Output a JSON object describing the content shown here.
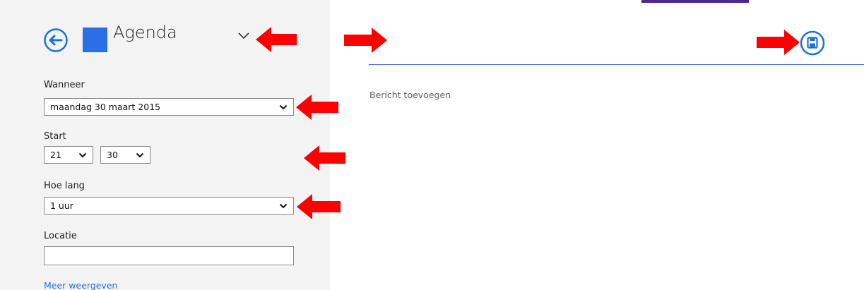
{
  "header": {
    "back_icon": "back-arrow-circle-icon",
    "calendar_color": "#2b6ee6",
    "calendar_name": "Agenda",
    "dropdown_icon": "chevron-down-icon"
  },
  "form": {
    "when": {
      "label": "Wanneer",
      "value": "maandag 30 maart 2015"
    },
    "start": {
      "label": "Start",
      "hour": "21",
      "minute": "30"
    },
    "duration": {
      "label": "Hoe lang",
      "value": "1 uur"
    },
    "location": {
      "label": "Locatie",
      "value": "",
      "placeholder": ""
    },
    "more_link": "Meer weergeven"
  },
  "main": {
    "message_placeholder": "Bericht toevoegen",
    "save_icon": "save-floppy-icon"
  },
  "colors": {
    "accent": "#1e6fd8",
    "divider": "#4a6fd3",
    "tab": "#4b2a8f",
    "annotation_arrow": "#ff0000"
  }
}
